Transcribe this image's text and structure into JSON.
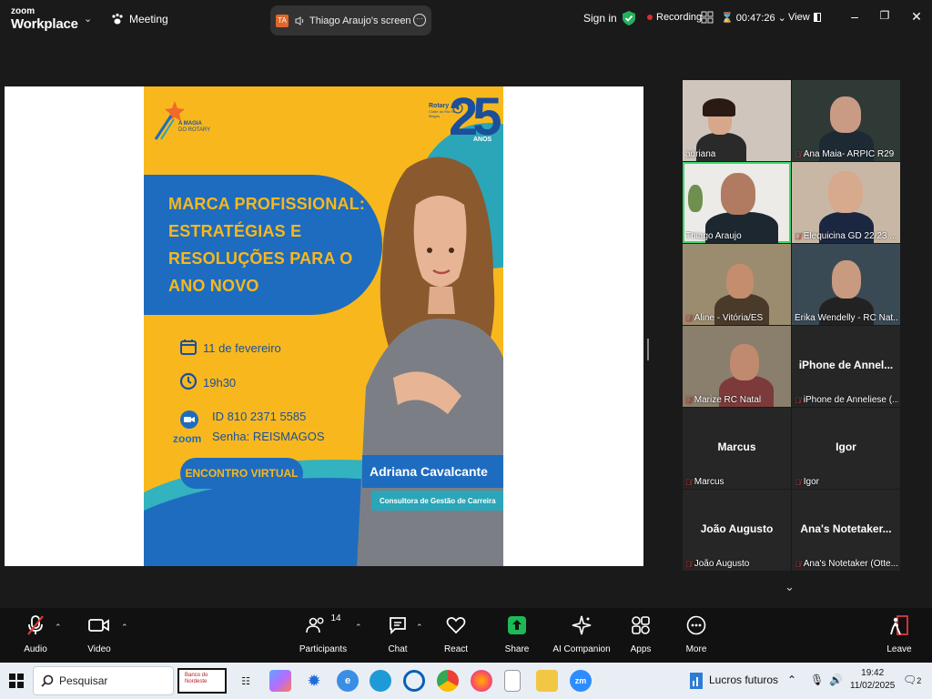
{
  "topbar": {
    "logo_line1": "zoom",
    "logo_line2": "Workplace",
    "meeting_label": "Meeting",
    "share_avatar": "TA",
    "share_label": "Thiago Araujo's screen",
    "sign_in": "Sign in",
    "recording": "Recording",
    "timer": "00:47:26",
    "view": "View",
    "icons": [
      "chevron-down-icon",
      "paw-icon",
      "speaker-icon",
      "more-icon",
      "shield-check-icon",
      "grid-icon",
      "hourglass-icon",
      "minimize-icon",
      "maximize-icon",
      "close-icon"
    ]
  },
  "poster": {
    "magia": [
      "A MAGIA",
      "DO ROTARY"
    ],
    "rotary": "Rotary",
    "club": "Clube do Rio Reis Magos",
    "anniv": "25",
    "anos": "ANOS",
    "title_lines": [
      "MARCA PROFISSIONAL:",
      "ESTRATÉGIAS E",
      "RESOLUÇÕES PARA O",
      "ANO NOVO"
    ],
    "date": "11 de fevereiro",
    "time": "19h30",
    "meeting_id": "ID 810 2371 5585",
    "password": "Senha: REISMAGOS",
    "zoom_label": "zoom",
    "event_type": "ENCONTRO VIRTUAL",
    "speaker_name": "Adriana Cavalcante",
    "speaker_role": "Consultora de Gestão de Carreira"
  },
  "participants": [
    {
      "name": "adriana",
      "muted": false,
      "video": true
    },
    {
      "name": "Ana Maia- ARPIC R29",
      "muted": true,
      "video": true
    },
    {
      "name": "Thiago Araujo",
      "muted": false,
      "video": true,
      "active": true
    },
    {
      "name": "Elequicina GD 22/23 ...",
      "muted": true,
      "video": true
    },
    {
      "name": "Aline - Vitória/ES",
      "muted": true,
      "video": true
    },
    {
      "name": "Érika Wendelly - RC Nat...",
      "muted": false,
      "video": true
    },
    {
      "name": "Marize RC Natal",
      "muted": true,
      "video": true
    },
    {
      "name": "iPhone de Anneliese (...",
      "muted": true,
      "video": false,
      "display": "iPhone de Annel..."
    },
    {
      "name": "Marcus",
      "muted": true,
      "video": false,
      "display": "Marcus"
    },
    {
      "name": "Igor",
      "muted": true,
      "video": false,
      "display": "Igor"
    },
    {
      "name": "João Augusto",
      "muted": true,
      "video": false,
      "display": "João Augusto"
    },
    {
      "name": "Ana's Notetaker (Otte...",
      "muted": true,
      "video": false,
      "display": "Ana's Notetaker..."
    }
  ],
  "toolbar": {
    "audio": "Audio",
    "video": "Video",
    "participants": "Participants",
    "participants_count": "14",
    "chat": "Chat",
    "react": "React",
    "share": "Share",
    "ai": "AI Companion",
    "apps": "Apps",
    "more": "More",
    "leave": "Leave",
    "share_color": "#1db954"
  },
  "taskbar": {
    "search_placeholder": "Pesquisar",
    "weather": "Lucros futuros",
    "time": "19:42",
    "date": "11/02/2025",
    "notifications": "2",
    "banner_line1": "Banco do",
    "banner_line2": "Nordeste"
  }
}
